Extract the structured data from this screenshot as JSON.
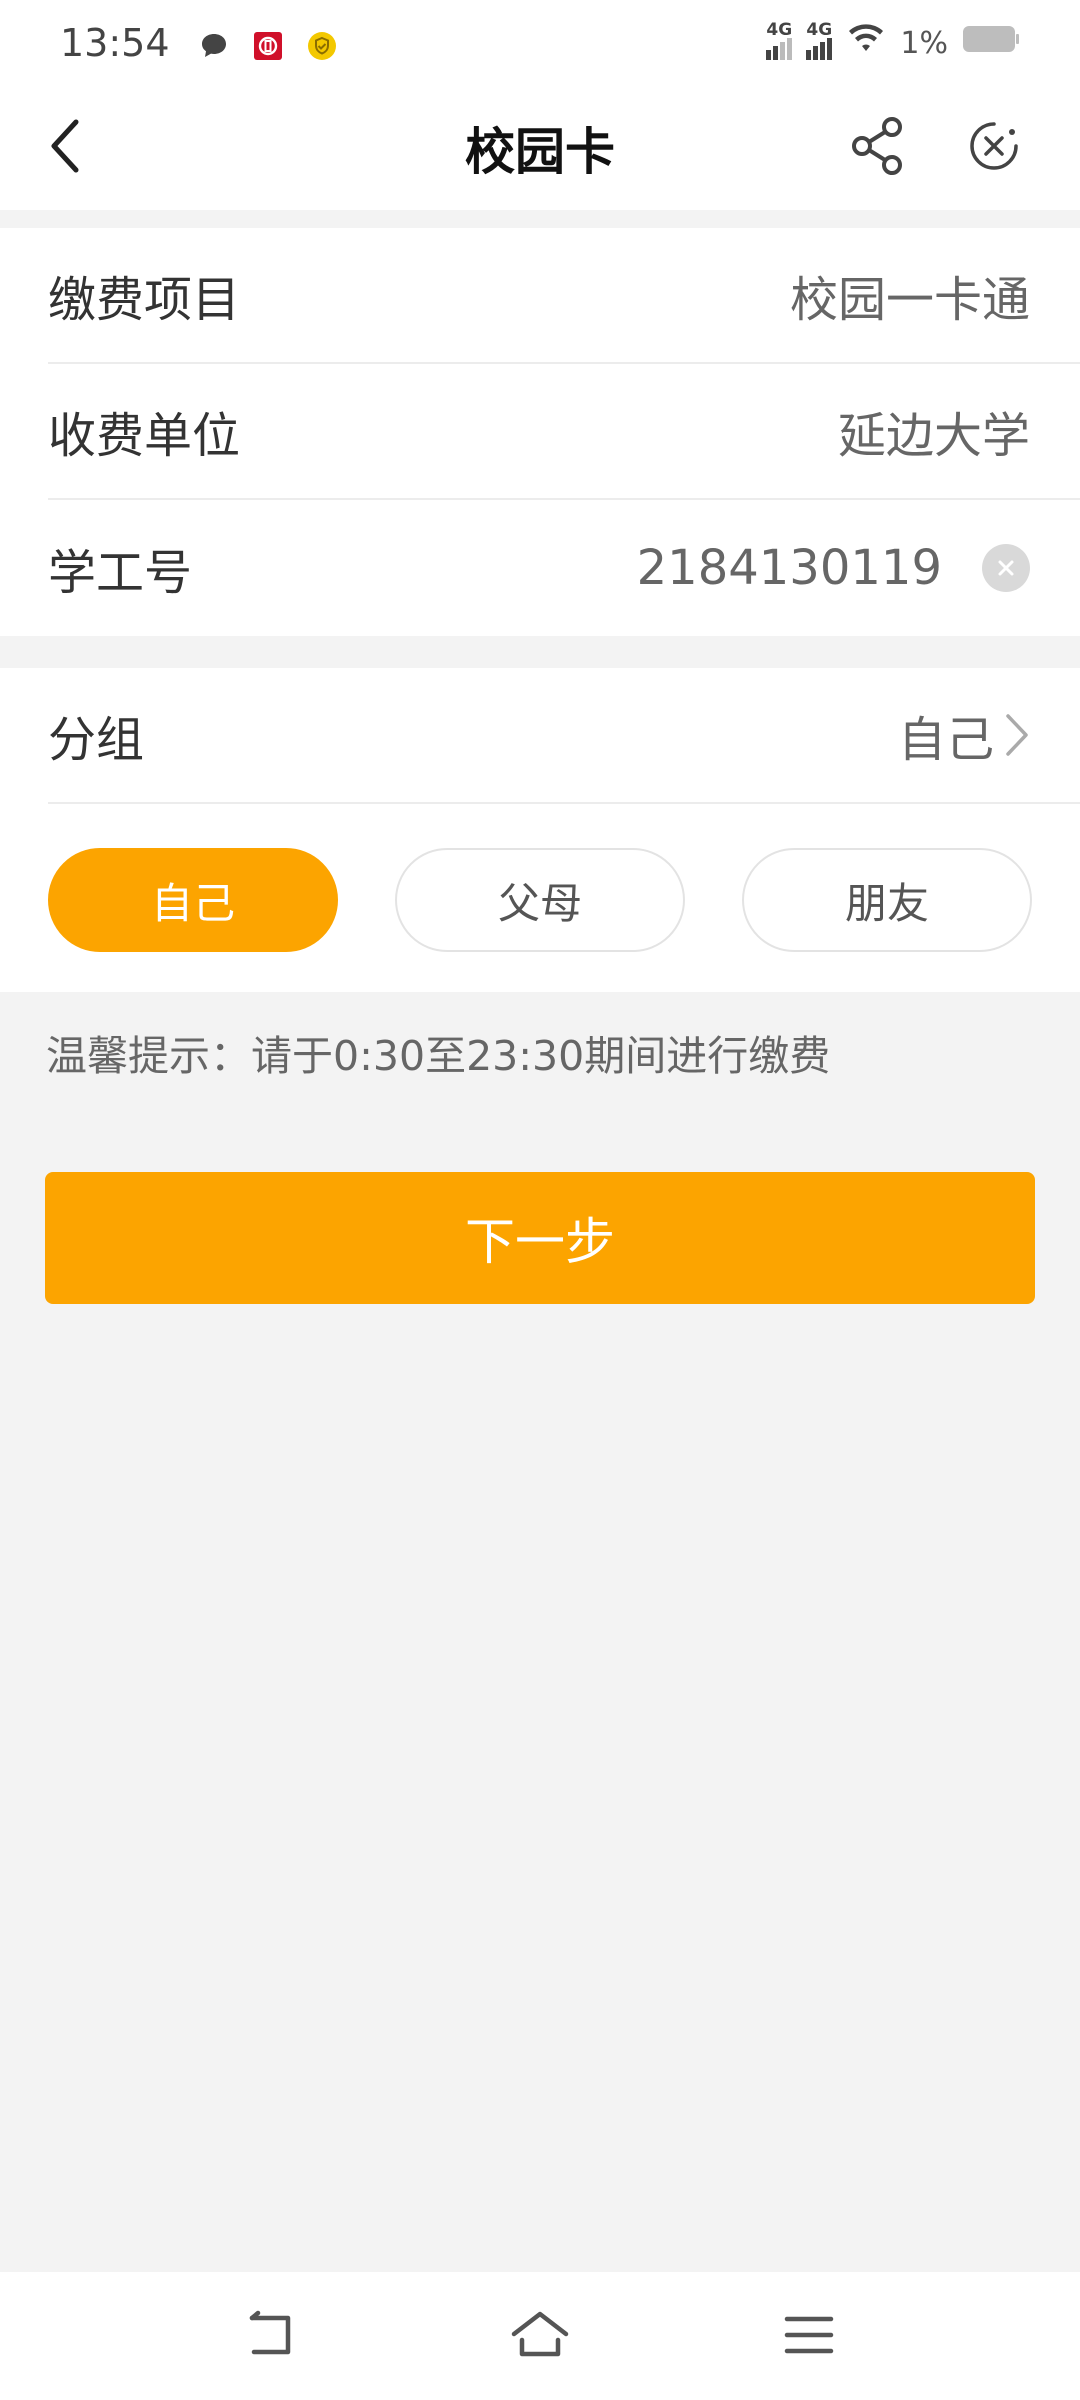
{
  "status_bar": {
    "time": "13:54",
    "network_1": "4G",
    "network_2": "4G",
    "battery": "1%",
    "icons": [
      "chat-bubble-icon",
      "bank-app-icon",
      "shield-check-icon",
      "signal-icon",
      "wifi-icon",
      "battery-icon"
    ]
  },
  "nav": {
    "title": "校园卡",
    "icons": [
      "back-arrow-icon",
      "share-icon",
      "close-circle-icon"
    ]
  },
  "form": {
    "payment_item": {
      "label": "缴费项目",
      "value": "校园一卡通"
    },
    "payee": {
      "label": "收费单位",
      "value": "延边大学"
    },
    "student_id": {
      "label": "学工号",
      "value": "2184130119"
    },
    "group": {
      "label": "分组",
      "value": "自己"
    }
  },
  "group_options": [
    {
      "label": "自己",
      "selected": true
    },
    {
      "label": "父母",
      "selected": false
    },
    {
      "label": "朋友",
      "selected": false
    }
  ],
  "tip": "温馨提示：请于0:30至23:30期间进行缴费",
  "next_button": "下一步",
  "colors": {
    "accent": "#fca400",
    "background": "#f3f3f3",
    "card": "#ffffff"
  },
  "system_nav": {
    "icons": [
      "back-icon",
      "home-icon",
      "menu-icon"
    ]
  }
}
